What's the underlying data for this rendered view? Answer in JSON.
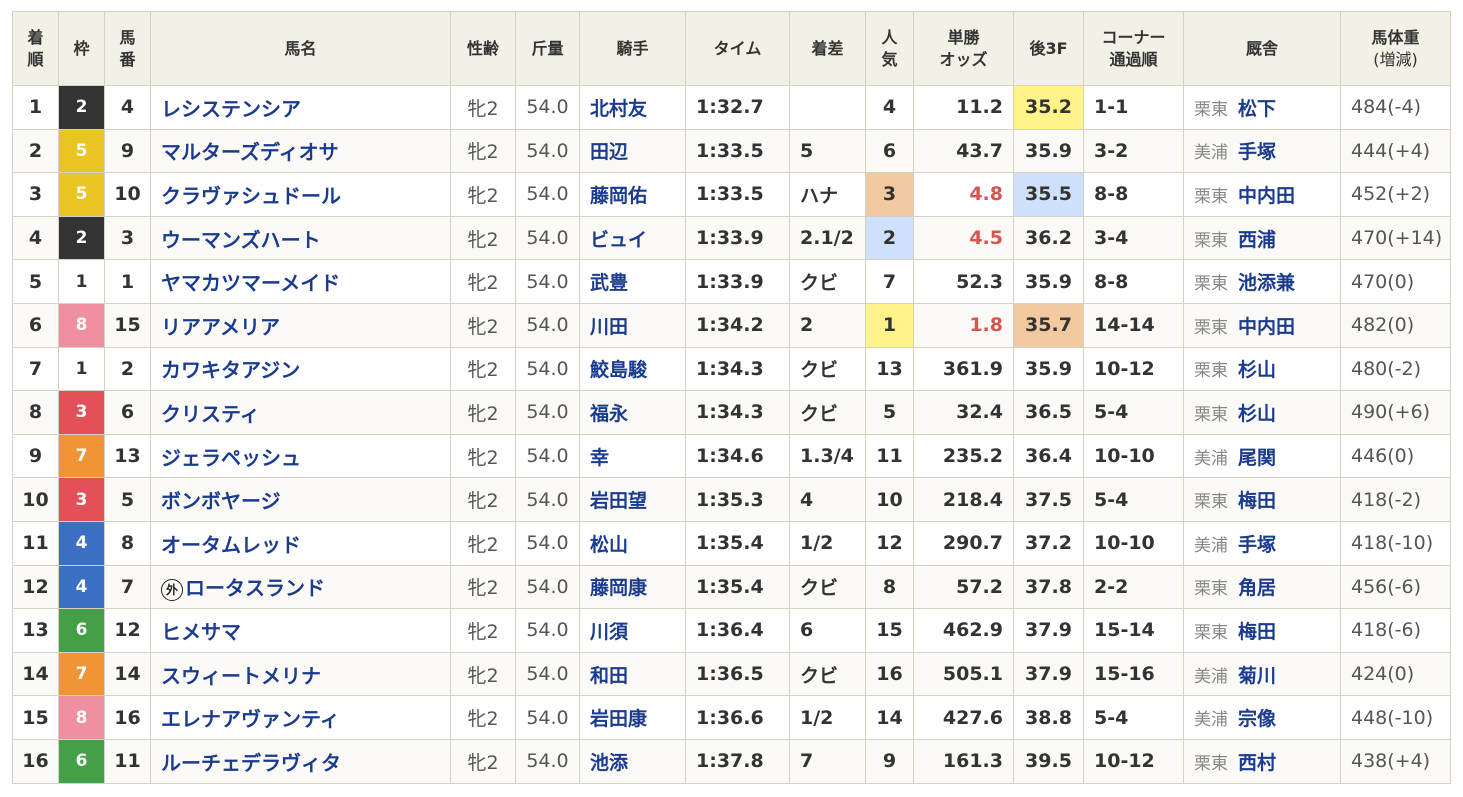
{
  "headers": {
    "rank": "着順",
    "waku": "枠",
    "umaban": "馬番",
    "name": "馬名",
    "sexage": "性齢",
    "weight": "斤量",
    "jockey": "騎手",
    "time": "タイム",
    "margin": "着差",
    "pop": "人気",
    "odds": "単勝オッズ",
    "last3f": "後3F",
    "corner": "コーナー通過順",
    "stable": "厩舎",
    "bodyweight": "馬体重(増減)"
  },
  "rows": [
    {
      "rank": "1",
      "waku": "2",
      "umaban": "4",
      "foreign": "",
      "name": "レシステンシア",
      "sexage": "牝2",
      "weight": "54.0",
      "jockey": "北村友",
      "time": "1:32.7",
      "margin": "",
      "pop": "4",
      "odds": "11.2",
      "last3f": "35.2",
      "corner": "1-1",
      "loc": "栗東",
      "trainer": "松下",
      "bw": "484(-4)"
    },
    {
      "rank": "2",
      "waku": "5",
      "umaban": "9",
      "foreign": "",
      "name": "マルターズディオサ",
      "sexage": "牝2",
      "weight": "54.0",
      "jockey": "田辺",
      "time": "1:33.5",
      "margin": "5",
      "pop": "6",
      "odds": "43.7",
      "last3f": "35.9",
      "corner": "3-2",
      "loc": "美浦",
      "trainer": "手塚",
      "bw": "444(+4)"
    },
    {
      "rank": "3",
      "waku": "5",
      "umaban": "10",
      "foreign": "",
      "name": "クラヴァシュドール",
      "sexage": "牝2",
      "weight": "54.0",
      "jockey": "藤岡佑",
      "time": "1:33.5",
      "margin": "ハナ",
      "pop": "3",
      "odds": "4.8",
      "last3f": "35.5",
      "corner": "8-8",
      "loc": "栗東",
      "trainer": "中内田",
      "bw": "452(+2)"
    },
    {
      "rank": "4",
      "waku": "2",
      "umaban": "3",
      "foreign": "",
      "name": "ウーマンズハート",
      "sexage": "牝2",
      "weight": "54.0",
      "jockey": "ビュイ",
      "time": "1:33.9",
      "margin": "2.1/2",
      "pop": "2",
      "odds": "4.5",
      "last3f": "36.2",
      "corner": "3-4",
      "loc": "栗東",
      "trainer": "西浦",
      "bw": "470(+14)"
    },
    {
      "rank": "5",
      "waku": "1",
      "umaban": "1",
      "foreign": "",
      "name": "ヤマカツマーメイド",
      "sexage": "牝2",
      "weight": "54.0",
      "jockey": "武豊",
      "time": "1:33.9",
      "margin": "クビ",
      "pop": "7",
      "odds": "52.3",
      "last3f": "35.9",
      "corner": "8-8",
      "loc": "栗東",
      "trainer": "池添兼",
      "bw": "470(0)"
    },
    {
      "rank": "6",
      "waku": "8",
      "umaban": "15",
      "foreign": "",
      "name": "リアアメリア",
      "sexage": "牝2",
      "weight": "54.0",
      "jockey": "川田",
      "time": "1:34.2",
      "margin": "2",
      "pop": "1",
      "odds": "1.8",
      "last3f": "35.7",
      "corner": "14-14",
      "loc": "栗東",
      "trainer": "中内田",
      "bw": "482(0)"
    },
    {
      "rank": "7",
      "waku": "1",
      "umaban": "2",
      "foreign": "",
      "name": "カワキタアジン",
      "sexage": "牝2",
      "weight": "54.0",
      "jockey": "鮫島駿",
      "time": "1:34.3",
      "margin": "クビ",
      "pop": "13",
      "odds": "361.9",
      "last3f": "35.9",
      "corner": "10-12",
      "loc": "栗東",
      "trainer": "杉山",
      "bw": "480(-2)"
    },
    {
      "rank": "8",
      "waku": "3",
      "umaban": "6",
      "foreign": "",
      "name": "クリスティ",
      "sexage": "牝2",
      "weight": "54.0",
      "jockey": "福永",
      "time": "1:34.3",
      "margin": "クビ",
      "pop": "5",
      "odds": "32.4",
      "last3f": "36.5",
      "corner": "5-4",
      "loc": "栗東",
      "trainer": "杉山",
      "bw": "490(+6)"
    },
    {
      "rank": "9",
      "waku": "7",
      "umaban": "13",
      "foreign": "",
      "name": "ジェラペッシュ",
      "sexage": "牝2",
      "weight": "54.0",
      "jockey": "幸",
      "time": "1:34.6",
      "margin": "1.3/4",
      "pop": "11",
      "odds": "235.2",
      "last3f": "36.4",
      "corner": "10-10",
      "loc": "美浦",
      "trainer": "尾関",
      "bw": "446(0)"
    },
    {
      "rank": "10",
      "waku": "3",
      "umaban": "5",
      "foreign": "",
      "name": "ボンボヤージ",
      "sexage": "牝2",
      "weight": "54.0",
      "jockey": "岩田望",
      "time": "1:35.3",
      "margin": "4",
      "pop": "10",
      "odds": "218.4",
      "last3f": "37.5",
      "corner": "5-4",
      "loc": "栗東",
      "trainer": "梅田",
      "bw": "418(-2)"
    },
    {
      "rank": "11",
      "waku": "4",
      "umaban": "8",
      "foreign": "",
      "name": "オータムレッド",
      "sexage": "牝2",
      "weight": "54.0",
      "jockey": "松山",
      "time": "1:35.4",
      "margin": "1/2",
      "pop": "12",
      "odds": "290.7",
      "last3f": "37.2",
      "corner": "10-10",
      "loc": "美浦",
      "trainer": "手塚",
      "bw": "418(-10)"
    },
    {
      "rank": "12",
      "waku": "4",
      "umaban": "7",
      "foreign": "外",
      "name": "ロータスランド",
      "sexage": "牝2",
      "weight": "54.0",
      "jockey": "藤岡康",
      "time": "1:35.4",
      "margin": "クビ",
      "pop": "8",
      "odds": "57.2",
      "last3f": "37.8",
      "corner": "2-2",
      "loc": "栗東",
      "trainer": "角居",
      "bw": "456(-6)"
    },
    {
      "rank": "13",
      "waku": "6",
      "umaban": "12",
      "foreign": "",
      "name": "ヒメサマ",
      "sexage": "牝2",
      "weight": "54.0",
      "jockey": "川須",
      "time": "1:36.4",
      "margin": "6",
      "pop": "15",
      "odds": "462.9",
      "last3f": "37.9",
      "corner": "15-14",
      "loc": "栗東",
      "trainer": "梅田",
      "bw": "418(-6)"
    },
    {
      "rank": "14",
      "waku": "7",
      "umaban": "14",
      "foreign": "",
      "name": "スウィートメリナ",
      "sexage": "牝2",
      "weight": "54.0",
      "jockey": "和田",
      "time": "1:36.5",
      "margin": "クビ",
      "pop": "16",
      "odds": "505.1",
      "last3f": "37.9",
      "corner": "15-16",
      "loc": "美浦",
      "trainer": "菊川",
      "bw": "424(0)"
    },
    {
      "rank": "15",
      "waku": "8",
      "umaban": "16",
      "foreign": "",
      "name": "エレナアヴァンティ",
      "sexage": "牝2",
      "weight": "54.0",
      "jockey": "岩田康",
      "time": "1:36.6",
      "margin": "1/2",
      "pop": "14",
      "odds": "427.6",
      "last3f": "38.8",
      "corner": "5-4",
      "loc": "美浦",
      "trainer": "宗像",
      "bw": "448(-10)"
    },
    {
      "rank": "16",
      "waku": "6",
      "umaban": "11",
      "foreign": "",
      "name": "ルーチェデラヴィタ",
      "sexage": "牝2",
      "weight": "54.0",
      "jockey": "池添",
      "time": "1:37.8",
      "margin": "7",
      "pop": "9",
      "odds": "161.3",
      "last3f": "39.5",
      "corner": "10-12",
      "loc": "栗東",
      "trainer": "西村",
      "bw": "438(+4)"
    }
  ],
  "waku_colors": {
    "1": {
      "bg": "#ffffff",
      "fg": "#333333"
    },
    "2": {
      "bg": "#333333",
      "fg": "#ffffff"
    },
    "3": {
      "bg": "#e4505a",
      "fg": "#ffffff"
    },
    "4": {
      "bg": "#3a6fc4",
      "fg": "#ffffff"
    },
    "5": {
      "bg": "#e8c523",
      "fg": "#ffffff"
    },
    "6": {
      "bg": "#43a047",
      "fg": "#ffffff"
    },
    "7": {
      "bg": "#ef9536",
      "fg": "#ffffff"
    },
    "8": {
      "bg": "#f08fa0",
      "fg": "#ffffff"
    }
  },
  "highlights": {
    "pop_1": "#fff38a",
    "pop_2": "#cfe0fa",
    "pop_3": "#f3c9a0",
    "f3_1": "#fff38a",
    "f3_2": "#cfe0fa",
    "f3_3": "#f3c9a0",
    "odds_hot": "#d9534f"
  }
}
